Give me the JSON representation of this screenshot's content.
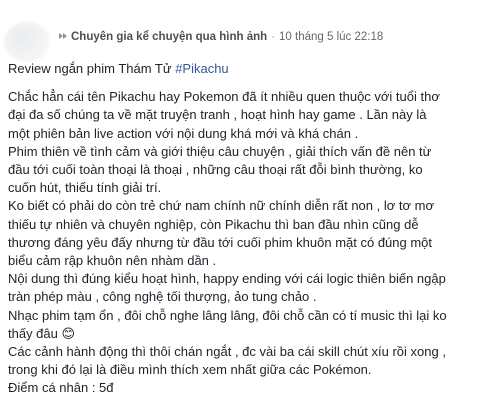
{
  "post": {
    "group_name": "Chuyên gia kể chuyện qua hình ảnh",
    "separator": "·",
    "timestamp": "10 tháng 5 lúc 22:18",
    "title_text": "Review ngắn phim Thám Tử ",
    "hashtag": "#Pikachu",
    "paragraphs": [
      "Chắc hẳn cái tên Pikachu hay Pokemon đã ít nhiều quen thuộc với tuổi thơ\nđại đa số chúng ta về mặt truyện tranh , hoạt hình hay game . Lần này là\nmột phiên bản live action với nội dung khá mới và khá chán .",
      "Phim thiên về tình cảm và giới thiệu câu chuyện , giải thích vấn đề nên từ\nđầu tới cuối toàn thoại là thoại , những câu thoại rất đỗi bình thường, ko\ncuốn hút, thiếu tính giải trí.",
      "Ko biết có phải do còn trẻ chứ nam chính nữ chính diễn rất non , lơ tơ mơ\nthiếu tự nhiên và chuyên nghiệp, còn Pikachu thì ban đầu nhìn cũng dễ\nthương đáng yêu đấy nhưng từ đầu tới cuối phim khuôn mặt có đúng một\nbiểu cảm rập khuôn nên nhàm dần .",
      "Nội dung thì đúng kiểu hoạt hình, happy ending với cái logic thiên biến ngập\ntràn phép màu , công nghệ tối thượng, ảo tung chảo .",
      "Nhạc phim tạm ổn , đôi chỗ nghe lâng lâng, đôi chỗ cần có tí music thì lại ko\nthấy đâu 😊",
      "Các cảnh hành động thì thôi chán ngắt , đc vài ba cái skill chút xíu rồi xong ,\ntrong khi đó lại là điều mình thích xem nhất giữa các Pokémon.",
      "Điểm cá nhân : 5đ"
    ]
  }
}
